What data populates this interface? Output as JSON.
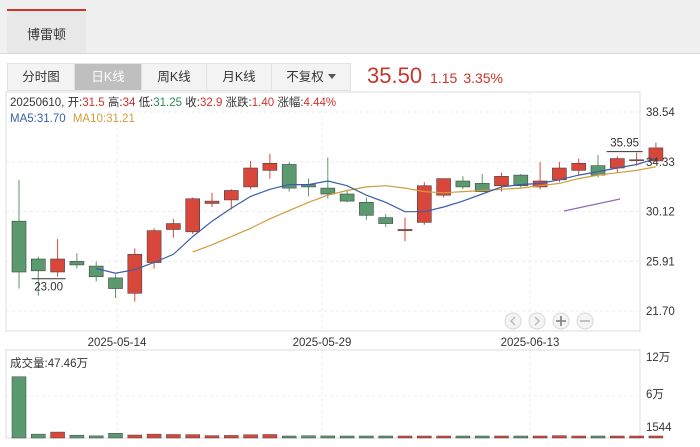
{
  "tabs": [
    {
      "label": "博雷顿",
      "active": true
    }
  ],
  "periods": [
    {
      "label": "分时图",
      "active": false
    },
    {
      "label": "日K线",
      "active": true
    },
    {
      "label": "周K线",
      "active": false
    },
    {
      "label": "月K线",
      "active": false
    },
    {
      "label": "不复权",
      "active": false,
      "dropdown": true
    }
  ],
  "quote": {
    "price": "35.50",
    "change": "1.15",
    "change_pct": "3.35%",
    "color": "#c8352c"
  },
  "info": {
    "date": "20250610",
    "open_label": "开:",
    "open": "31.5",
    "high_label": "高:",
    "high": "34",
    "low_label": "低:",
    "low": "31.25",
    "close_label": "收:",
    "close": "32.9",
    "change_label": "涨跌:",
    "change": "1.40",
    "pct_label": "涨幅:",
    "pct": "4.44%"
  },
  "ma": {
    "ma5": "MA5:31.70",
    "ma10": "MA10:31.21",
    "ma5_color": "#3a5ea8",
    "ma10_color": "#d39c3b"
  },
  "volume": {
    "label": "成交量:47.46万"
  },
  "chart_data": {
    "type": "candlestick",
    "y_ticks": [
      "38.54",
      "34.33",
      "30.12",
      "25.91",
      "21.70"
    ],
    "ylim": [
      21.7,
      38.54
    ],
    "x_tick_labels": [
      "2025-05-14",
      "2025-05-29",
      "2025-06-13"
    ],
    "x_tick_index": [
      5,
      16,
      27
    ],
    "annotations": [
      {
        "text": "35.95",
        "kind": "max",
        "index": 32
      },
      {
        "text": "23.00",
        "kind": "min",
        "index": 2
      }
    ],
    "up_color": "#d9473b",
    "down_color": "#5a9a6e",
    "candles": [
      {
        "o": 29.3,
        "h": 32.8,
        "l": 23.6,
        "c": 25.0
      },
      {
        "o": 26.1,
        "h": 26.3,
        "l": 23.0,
        "c": 25.1
      },
      {
        "o": 25.0,
        "h": 27.8,
        "l": 24.6,
        "c": 26.1
      },
      {
        "o": 25.9,
        "h": 26.6,
        "l": 25.3,
        "c": 25.6
      },
      {
        "o": 25.5,
        "h": 25.9,
        "l": 24.2,
        "c": 24.6
      },
      {
        "o": 24.5,
        "h": 24.8,
        "l": 22.8,
        "c": 23.6
      },
      {
        "o": 23.2,
        "h": 27.0,
        "l": 22.5,
        "c": 26.5
      },
      {
        "o": 25.8,
        "h": 28.7,
        "l": 25.3,
        "c": 28.5
      },
      {
        "o": 28.6,
        "h": 29.5,
        "l": 27.9,
        "c": 29.1
      },
      {
        "o": 28.4,
        "h": 31.3,
        "l": 28.2,
        "c": 31.2
      },
      {
        "o": 30.8,
        "h": 31.7,
        "l": 30.5,
        "c": 31.0
      },
      {
        "o": 31.1,
        "h": 32.0,
        "l": 30.3,
        "c": 31.9
      },
      {
        "o": 32.2,
        "h": 34.4,
        "l": 32.0,
        "c": 33.8
      },
      {
        "o": 33.6,
        "h": 35.0,
        "l": 32.9,
        "c": 34.2
      },
      {
        "o": 34.1,
        "h": 34.3,
        "l": 31.8,
        "c": 32.1
      },
      {
        "o": 32.4,
        "h": 32.9,
        "l": 31.4,
        "c": 32.2
      },
      {
        "o": 32.1,
        "h": 34.7,
        "l": 31.2,
        "c": 31.6
      },
      {
        "o": 31.6,
        "h": 31.9,
        "l": 30.9,
        "c": 31.0
      },
      {
        "o": 30.9,
        "h": 31.3,
        "l": 29.4,
        "c": 29.8
      },
      {
        "o": 29.6,
        "h": 29.9,
        "l": 28.8,
        "c": 29.1
      },
      {
        "o": 28.5,
        "h": 29.6,
        "l": 27.6,
        "c": 28.6
      },
      {
        "o": 29.2,
        "h": 32.6,
        "l": 29.0,
        "c": 32.3
      },
      {
        "o": 31.5,
        "h": 32.9,
        "l": 31.3,
        "c": 32.9
      },
      {
        "o": 32.7,
        "h": 33.1,
        "l": 32.0,
        "c": 32.2
      },
      {
        "o": 32.5,
        "h": 33.3,
        "l": 32.0,
        "c": 31.8
      },
      {
        "o": 32.3,
        "h": 33.4,
        "l": 31.8,
        "c": 33.1
      },
      {
        "o": 33.2,
        "h": 33.3,
        "l": 32.1,
        "c": 32.3
      },
      {
        "o": 32.2,
        "h": 34.3,
        "l": 32.0,
        "c": 32.7
      },
      {
        "o": 32.8,
        "h": 34.3,
        "l": 32.6,
        "c": 33.8
      },
      {
        "o": 33.6,
        "h": 34.6,
        "l": 33.2,
        "c": 34.2
      },
      {
        "o": 34.0,
        "h": 34.9,
        "l": 33.0,
        "c": 33.2
      },
      {
        "o": 33.8,
        "h": 34.8,
        "l": 33.4,
        "c": 34.6
      },
      {
        "o": 34.5,
        "h": 35.1,
        "l": 34.0,
        "c": 34.5
      },
      {
        "o": 34.4,
        "h": 35.95,
        "l": 34.3,
        "c": 35.5
      }
    ],
    "ma5": [
      null,
      null,
      null,
      null,
      25.3,
      24.9,
      25.2,
      25.8,
      26.5,
      28.0,
      29.3,
      30.4,
      31.4,
      32.0,
      32.4,
      32.4,
      32.7,
      32.3,
      31.5,
      30.9,
      30.1,
      30.1,
      30.5,
      31.0,
      31.6,
      32.2,
      32.4,
      32.5,
      32.8,
      33.2,
      33.5,
      33.8,
      34.1,
      34.6
    ],
    "ma10": [
      null,
      null,
      null,
      null,
      null,
      null,
      null,
      null,
      null,
      26.7,
      27.3,
      28.0,
      28.7,
      29.5,
      30.2,
      30.9,
      31.5,
      31.9,
      32.2,
      32.3,
      32.1,
      31.8,
      31.7,
      31.8,
      31.9,
      32.0,
      32.1,
      32.3,
      32.5,
      32.9,
      33.2,
      33.4,
      33.6,
      33.9
    ],
    "volume": {
      "y_ticks": [
        "12万",
        "6万",
        "1544"
      ],
      "ylim": [
        0,
        120000
      ],
      "values": [
        98000,
        6200,
        9500,
        4500,
        3400,
        7500,
        4800,
        6200,
        5600,
        5400,
        3800,
        4100,
        5200,
        5600,
        2500,
        3600,
        3300,
        2500,
        1900,
        2400,
        2200,
        2600,
        2700,
        2500,
        2600,
        2800,
        2400,
        2700,
        3800,
        2900,
        2600,
        2700,
        2500,
        2900
      ]
    }
  }
}
